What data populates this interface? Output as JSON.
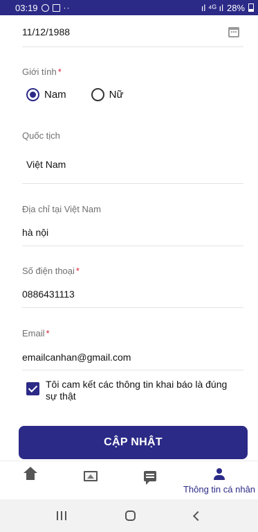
{
  "status_bar": {
    "time": "03:19",
    "battery": "28%",
    "signal_text": "ıl ⁴ᴳ ıl",
    "left_icons_label": "··"
  },
  "form": {
    "dob": {
      "value": "11/12/1988"
    },
    "gender": {
      "label": "Giới tính",
      "required_mark": "*",
      "options": [
        {
          "label": "Nam",
          "selected": true
        },
        {
          "label": "Nữ",
          "selected": false
        }
      ]
    },
    "nationality": {
      "label": "Quốc tịch",
      "value": "Việt Nam"
    },
    "address": {
      "label": "Địa chỉ tại Việt Nam",
      "value": "hà nội"
    },
    "phone": {
      "label": "Số điện thoại",
      "required_mark": "*",
      "value": "0886431113"
    },
    "email": {
      "label": "Email",
      "required_mark": "*",
      "value": "emailcanhan@gmail.com"
    },
    "commitment": {
      "text": "Tôi cam kết các thông tin khai báo là đúng sự thật",
      "checked": true
    },
    "submit_label": "CẬP NHẬT"
  },
  "bottom_nav": {
    "items": [
      {
        "icon": "home-icon"
      },
      {
        "icon": "image-icon"
      },
      {
        "icon": "message-icon"
      },
      {
        "icon": "user-icon",
        "label": "Thông tin cá nhân",
        "active": true
      }
    ]
  },
  "colors": {
    "primary": "#2b2a87",
    "required": "#d6213a",
    "divider": "#e4e4e4"
  }
}
